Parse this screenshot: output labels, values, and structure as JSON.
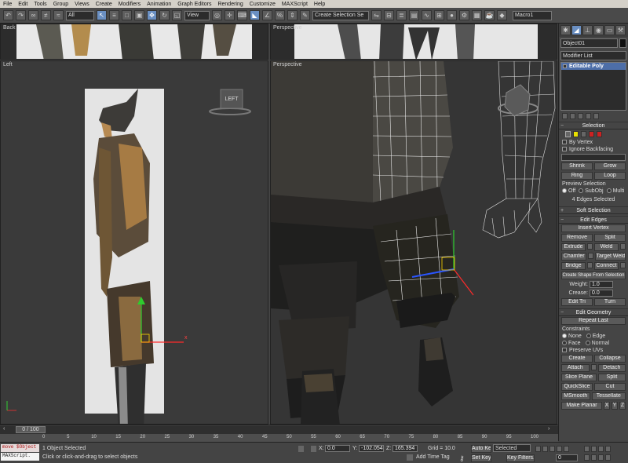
{
  "menu": [
    "File",
    "Edit",
    "Tools",
    "Group",
    "Views",
    "Create",
    "Modifiers",
    "Animation",
    "Graph Editors",
    "Rendering",
    "Customize",
    "MAXScript",
    "Help"
  ],
  "toolbar": {
    "filter": "All",
    "ref_coord": "View",
    "selection_set": "Create Selection Se",
    "macro": "Macro1"
  },
  "viewports": {
    "top_left": "Back",
    "top_right": "Perspective",
    "left": "Left",
    "right": "Perspective",
    "viewcube": "LEFT",
    "axis_x": "x"
  },
  "panel": {
    "object_name": "Object01",
    "modifier_list": "Modifier List",
    "stack_item": "Editable Poly",
    "selection": {
      "title": "Selection",
      "by_vertex": "By Vertex",
      "ignore_backfacing": "Ignore Backfacing",
      "shrink": "Shrink",
      "grow": "Grow",
      "ring": "Ring",
      "loop": "Loop",
      "preview": "Preview Selection",
      "off": "Off",
      "subobj": "SubObj",
      "multi": "Multi",
      "status": "4 Edges Selected"
    },
    "soft_selection": "Soft Selection",
    "edit_edges": {
      "title": "Edit Edges",
      "insert_vertex": "Insert Vertex",
      "remove": "Remove",
      "split": "Split",
      "extrude": "Extrude",
      "weld": "Weld",
      "chamfer": "Chamfer",
      "target_weld": "Target Weld",
      "bridge": "Bridge",
      "connect": "Connect",
      "create_shape": "Create Shape From Selection",
      "weight_label": "Weight:",
      "weight": "1.0",
      "crease_label": "Crease:",
      "crease": "0.0",
      "edit_tri": "Edit Tri",
      "turn": "Turn"
    },
    "edit_geometry": {
      "title": "Edit Geometry",
      "repeat_last": "Repeat Last",
      "constraints": "Constraints",
      "none": "None",
      "edge": "Edge",
      "face": "Face",
      "normal": "Normal",
      "preserve_uvs": "Preserve UVs",
      "create": "Create",
      "collapse": "Collapse",
      "attach": "Attach",
      "detach": "Detach",
      "slice_plane": "Slice Plane",
      "split": "Split",
      "quickslice": "QuickSlice",
      "cut": "Cut",
      "msmooth": "MSmooth",
      "tessellate": "Tessellate",
      "make_planar": "Make Planar",
      "x": "X",
      "y": "Y",
      "z": "Z"
    }
  },
  "timeline": {
    "frame": "0 / 100",
    "ticks": [
      "0",
      "5",
      "10",
      "15",
      "20",
      "25",
      "30",
      "35",
      "40",
      "45",
      "50",
      "55",
      "60",
      "65",
      "70",
      "75",
      "80",
      "85",
      "90",
      "95",
      "100"
    ]
  },
  "status": {
    "maxscript_1": "move $Object",
    "maxscript_2": "MAXScript.",
    "selected": "1 Object Selected",
    "prompt": "Click or click-and-drag to select objects",
    "x_label": "X:",
    "x_val": "0.0",
    "y_label": "Y:",
    "y_val": "-102.054",
    "z_label": "Z:",
    "z_val": "165.394",
    "grid": "Grid = 10.0",
    "add_time_tag": "Add Time Tag",
    "auto_key": "Auto Key",
    "set_key": "Set Key",
    "key_mode": "Selected",
    "key_filters": "Key Filters...",
    "frame": "0"
  }
}
